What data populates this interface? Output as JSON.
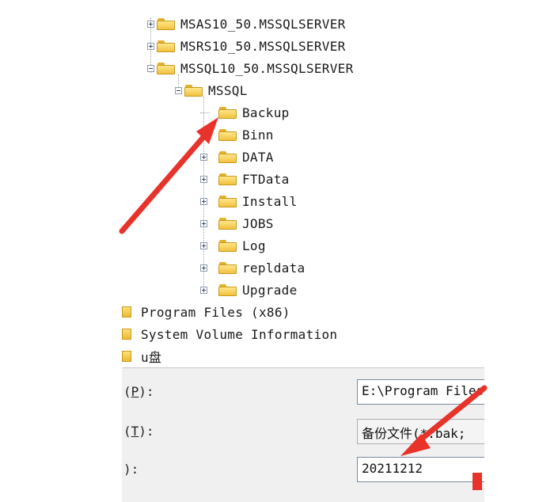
{
  "tree": {
    "top_nodes": [
      {
        "label": "MSAS10_50.MSSQLSERVER",
        "expander": "plus"
      },
      {
        "label": "MSRS10_50.MSSQLSERVER",
        "expander": "plus"
      },
      {
        "label": "MSSQL10_50.MSSQLSERVER",
        "expander": "minus"
      }
    ],
    "mssql_node": {
      "label": "MSSQL",
      "expander": "minus"
    },
    "children": [
      {
        "label": "Backup",
        "expander": "none"
      },
      {
        "label": "Binn",
        "expander": "none"
      },
      {
        "label": "DATA",
        "expander": "plus"
      },
      {
        "label": "FTData",
        "expander": "plus"
      },
      {
        "label": "Install",
        "expander": "plus"
      },
      {
        "label": "JOBS",
        "expander": "plus"
      },
      {
        "label": "Log",
        "expander": "plus"
      },
      {
        "label": "repldata",
        "expander": "plus"
      },
      {
        "label": "Upgrade",
        "expander": "plus"
      }
    ],
    "drives": [
      {
        "label": "Program Files (x86)"
      },
      {
        "label": "System Volume Information"
      },
      {
        "label": "u盘"
      }
    ]
  },
  "dialog": {
    "path_label_prefix": "(",
    "path_label_key": "P",
    "path_label_suffix": "):",
    "path_value": "E:\\Program Files",
    "type_label_prefix": "(",
    "type_label_key": "T",
    "type_label_suffix": "):",
    "type_value": "备份文件(*.bak;",
    "name_label": "):",
    "name_value": "20211212"
  },
  "colors": {
    "arrow": "#e8332a",
    "folder": "#f1c13e"
  }
}
